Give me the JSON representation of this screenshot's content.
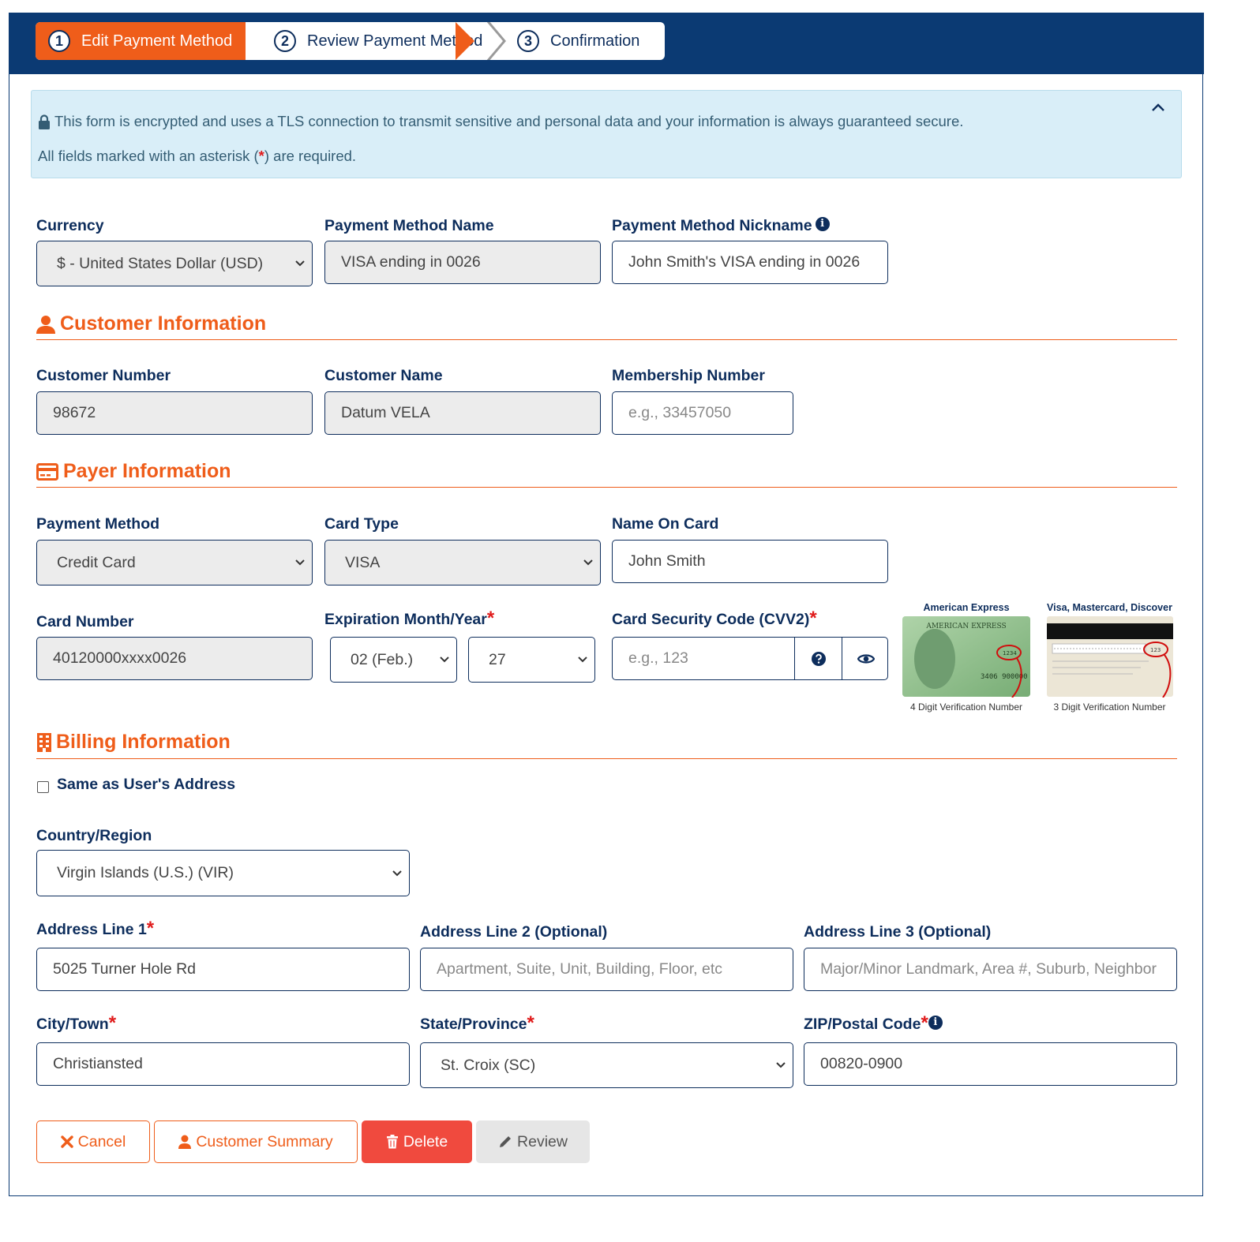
{
  "steps": [
    {
      "num": "1",
      "label": "Edit Payment Method"
    },
    {
      "num": "2",
      "label": "Review Payment Method"
    },
    {
      "num": "3",
      "label": "Confirmation"
    }
  ],
  "notice": {
    "line1": "This form is encrypted and uses a TLS connection to transmit sensitive and personal data and your information is always guaranteed secure.",
    "line2_prefix": "All fields marked with an asterisk (",
    "line2_star": "*",
    "line2_suffix": ") are required."
  },
  "currency": {
    "label": "Currency",
    "value": "$ - United States Dollar (USD)"
  },
  "pm_name": {
    "label": "Payment Method Name",
    "value": "VISA ending in 0026"
  },
  "pm_nickname": {
    "label": "Payment Method Nickname",
    "value": "John Smith's VISA ending in 0026"
  },
  "customer_section": {
    "title": "Customer Information"
  },
  "customer_number": {
    "label": "Customer Number",
    "value": "98672"
  },
  "customer_name": {
    "label": "Customer Name",
    "value": "Datum VELA"
  },
  "membership_number": {
    "label": "Membership Number",
    "placeholder": "e.g., 33457050"
  },
  "payer_section": {
    "title": "Payer Information"
  },
  "payment_method": {
    "label": "Payment Method",
    "value": "Credit Card"
  },
  "card_type": {
    "label": "Card Type",
    "value": "VISA"
  },
  "name_on_card": {
    "label": "Name On Card",
    "value": "John Smith"
  },
  "card_number": {
    "label": "Card Number",
    "value": "40120000xxxx0026"
  },
  "expiration": {
    "label": "Expiration Month/Year",
    "star": "*",
    "month": "02 (Feb.)",
    "year": "27"
  },
  "cvv": {
    "label": "Card Security Code (CVV2)",
    "star": "*",
    "placeholder": "e.g., 123"
  },
  "card_images": [
    {
      "caption": "American Express",
      "sub": "4 Digit Verification Number",
      "brand_text": "AMERICAN EXPRESS",
      "sample_code": "1234"
    },
    {
      "caption": "Visa, Mastercard, Discover",
      "sub": "3 Digit Verification Number",
      "sample_code": "123"
    }
  ],
  "billing_section": {
    "title": "Billing Information"
  },
  "same_address": {
    "label": "Same as User's Address",
    "checked": false
  },
  "country": {
    "label": "Country/Region",
    "value": "Virgin Islands (U.S.) (VIR)"
  },
  "address1": {
    "label": "Address Line 1",
    "star": "*",
    "value": "5025 Turner Hole Rd"
  },
  "address2": {
    "label": "Address Line 2 (Optional)",
    "placeholder": "Apartment, Suite, Unit, Building, Floor, etc"
  },
  "address3": {
    "label": "Address Line 3 (Optional)",
    "placeholder": "Major/Minor Landmark, Area #, Suburb, Neighbor"
  },
  "city": {
    "label": "City/Town",
    "star": "*",
    "value": "Christiansted"
  },
  "state": {
    "label": "State/Province",
    "star": "*",
    "value": "St. Croix (SC)"
  },
  "zip": {
    "label": "ZIP/Postal Code",
    "star": "*",
    "value": "00820-0900"
  },
  "buttons": {
    "cancel": "Cancel",
    "customer_summary": "Customer Summary",
    "delete": "Delete",
    "review": "Review"
  },
  "colors": {
    "navy": "#0b3a73",
    "orange": "#ef5d1a",
    "danger": "#f04a3e",
    "info_bg": "#d9eef8"
  }
}
